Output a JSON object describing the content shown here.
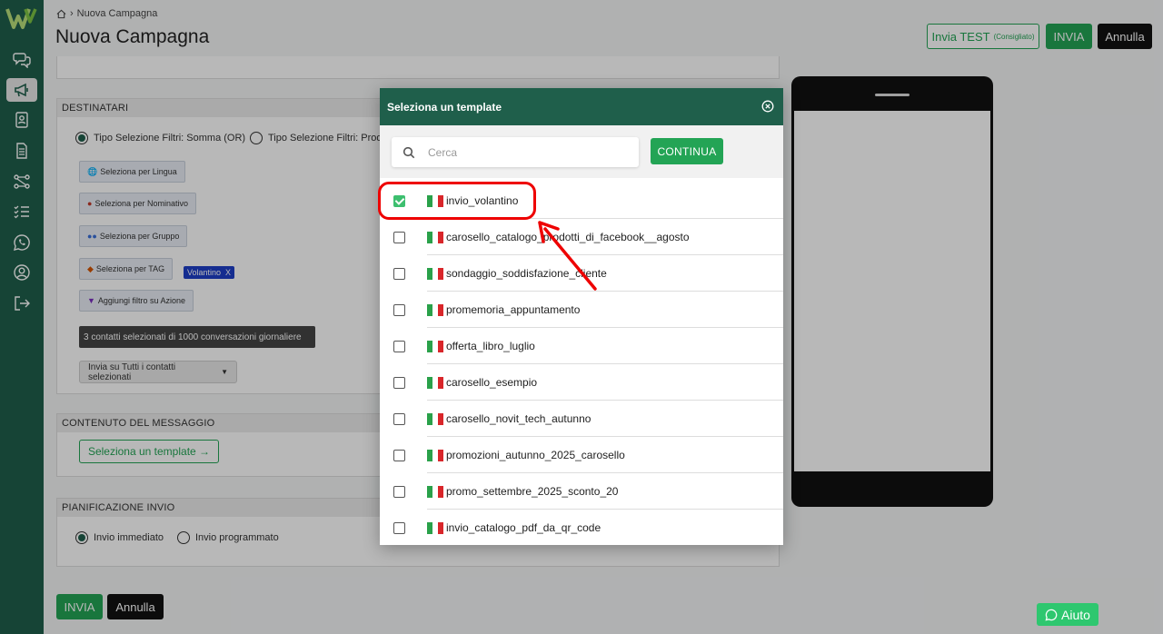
{
  "breadcrumb": {
    "current": "Nuova Campagna"
  },
  "page": {
    "title": "Nuova Campagna"
  },
  "toolbar": {
    "test_label": "Invia TEST",
    "test_hint": "(Consigliato)",
    "send_label": "INVIA",
    "cancel_label": "Annulla"
  },
  "recipients": {
    "header": "DESTINATARI",
    "filter_sum": "Tipo Selezione Filtri: Somma (OR)",
    "filter_product": "Tipo Selezione Filtri: Prodo",
    "btn_language": "Seleziona per Lingua",
    "btn_name": "Seleziona per Nominativo",
    "btn_group": "Seleziona per Gruppo",
    "btn_tag": "Seleziona per TAG",
    "tag_value": "Volantino",
    "tag_remove": "X",
    "btn_action": "Aggiungi filtro su Azione",
    "info": "3 contatti selezionati di 1000 conversazioni giornaliere",
    "send_mode": "Invia su Tutti i contatti selezionati"
  },
  "content": {
    "header": "CONTENUTO DEL MESSAGGIO",
    "select_template": "Seleziona un template →"
  },
  "schedule": {
    "header": "PIANIFICAZIONE INVIO",
    "immediate": "Invio immediato",
    "scheduled": "Invio programmato"
  },
  "footer": {
    "send_label": "INVIA",
    "cancel_label": "Annulla"
  },
  "help": {
    "label": "Aiuto"
  },
  "modal": {
    "title": "Seleziona un template",
    "search_placeholder": "Cerca",
    "continue_label": "CONTINUA",
    "templates": [
      {
        "name": "invio_volantino",
        "checked": true
      },
      {
        "name": "carosello_catalogo_prodotti_di_facebook__agosto",
        "checked": false
      },
      {
        "name": "sondaggio_soddisfazione_cliente",
        "checked": false
      },
      {
        "name": "promemoria_appuntamento",
        "checked": false
      },
      {
        "name": "offerta_libro_luglio",
        "checked": false
      },
      {
        "name": "carosello_esempio",
        "checked": false
      },
      {
        "name": "carosello_novit_tech_autunno",
        "checked": false
      },
      {
        "name": "promozioni_autunno_2025_carosello",
        "checked": false
      },
      {
        "name": "promo_settembre_2025_sconto_20",
        "checked": false
      },
      {
        "name": "invio_catalogo_pdf_da_qr_code",
        "checked": false
      }
    ]
  },
  "colors": {
    "brand_green": "#1f5f4b",
    "accent_green": "#23a455",
    "annotation_red": "#e00000"
  }
}
